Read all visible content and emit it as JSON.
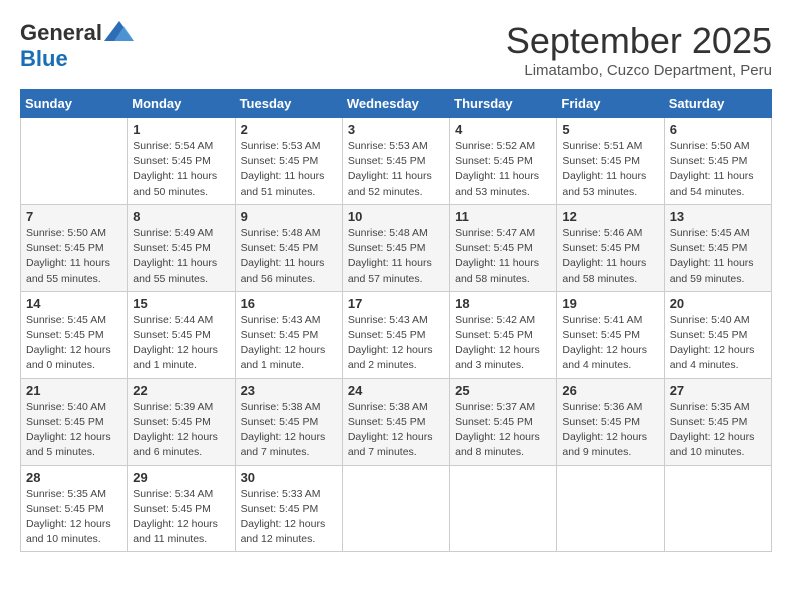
{
  "header": {
    "logo_general": "General",
    "logo_blue": "Blue",
    "month": "September 2025",
    "location": "Limatambo, Cuzco Department, Peru"
  },
  "days_of_week": [
    "Sunday",
    "Monday",
    "Tuesday",
    "Wednesday",
    "Thursday",
    "Friday",
    "Saturday"
  ],
  "weeks": [
    [
      {
        "day": "",
        "info": ""
      },
      {
        "day": "1",
        "info": "Sunrise: 5:54 AM\nSunset: 5:45 PM\nDaylight: 11 hours\nand 50 minutes."
      },
      {
        "day": "2",
        "info": "Sunrise: 5:53 AM\nSunset: 5:45 PM\nDaylight: 11 hours\nand 51 minutes."
      },
      {
        "day": "3",
        "info": "Sunrise: 5:53 AM\nSunset: 5:45 PM\nDaylight: 11 hours\nand 52 minutes."
      },
      {
        "day": "4",
        "info": "Sunrise: 5:52 AM\nSunset: 5:45 PM\nDaylight: 11 hours\nand 53 minutes."
      },
      {
        "day": "5",
        "info": "Sunrise: 5:51 AM\nSunset: 5:45 PM\nDaylight: 11 hours\nand 53 minutes."
      },
      {
        "day": "6",
        "info": "Sunrise: 5:50 AM\nSunset: 5:45 PM\nDaylight: 11 hours\nand 54 minutes."
      }
    ],
    [
      {
        "day": "7",
        "info": "Sunrise: 5:50 AM\nSunset: 5:45 PM\nDaylight: 11 hours\nand 55 minutes."
      },
      {
        "day": "8",
        "info": "Sunrise: 5:49 AM\nSunset: 5:45 PM\nDaylight: 11 hours\nand 55 minutes."
      },
      {
        "day": "9",
        "info": "Sunrise: 5:48 AM\nSunset: 5:45 PM\nDaylight: 11 hours\nand 56 minutes."
      },
      {
        "day": "10",
        "info": "Sunrise: 5:48 AM\nSunset: 5:45 PM\nDaylight: 11 hours\nand 57 minutes."
      },
      {
        "day": "11",
        "info": "Sunrise: 5:47 AM\nSunset: 5:45 PM\nDaylight: 11 hours\nand 58 minutes."
      },
      {
        "day": "12",
        "info": "Sunrise: 5:46 AM\nSunset: 5:45 PM\nDaylight: 11 hours\nand 58 minutes."
      },
      {
        "day": "13",
        "info": "Sunrise: 5:45 AM\nSunset: 5:45 PM\nDaylight: 11 hours\nand 59 minutes."
      }
    ],
    [
      {
        "day": "14",
        "info": "Sunrise: 5:45 AM\nSunset: 5:45 PM\nDaylight: 12 hours\nand 0 minutes."
      },
      {
        "day": "15",
        "info": "Sunrise: 5:44 AM\nSunset: 5:45 PM\nDaylight: 12 hours\nand 1 minute."
      },
      {
        "day": "16",
        "info": "Sunrise: 5:43 AM\nSunset: 5:45 PM\nDaylight: 12 hours\nand 1 minute."
      },
      {
        "day": "17",
        "info": "Sunrise: 5:43 AM\nSunset: 5:45 PM\nDaylight: 12 hours\nand 2 minutes."
      },
      {
        "day": "18",
        "info": "Sunrise: 5:42 AM\nSunset: 5:45 PM\nDaylight: 12 hours\nand 3 minutes."
      },
      {
        "day": "19",
        "info": "Sunrise: 5:41 AM\nSunset: 5:45 PM\nDaylight: 12 hours\nand 4 minutes."
      },
      {
        "day": "20",
        "info": "Sunrise: 5:40 AM\nSunset: 5:45 PM\nDaylight: 12 hours\nand 4 minutes."
      }
    ],
    [
      {
        "day": "21",
        "info": "Sunrise: 5:40 AM\nSunset: 5:45 PM\nDaylight: 12 hours\nand 5 minutes."
      },
      {
        "day": "22",
        "info": "Sunrise: 5:39 AM\nSunset: 5:45 PM\nDaylight: 12 hours\nand 6 minutes."
      },
      {
        "day": "23",
        "info": "Sunrise: 5:38 AM\nSunset: 5:45 PM\nDaylight: 12 hours\nand 7 minutes."
      },
      {
        "day": "24",
        "info": "Sunrise: 5:38 AM\nSunset: 5:45 PM\nDaylight: 12 hours\nand 7 minutes."
      },
      {
        "day": "25",
        "info": "Sunrise: 5:37 AM\nSunset: 5:45 PM\nDaylight: 12 hours\nand 8 minutes."
      },
      {
        "day": "26",
        "info": "Sunrise: 5:36 AM\nSunset: 5:45 PM\nDaylight: 12 hours\nand 9 minutes."
      },
      {
        "day": "27",
        "info": "Sunrise: 5:35 AM\nSunset: 5:45 PM\nDaylight: 12 hours\nand 10 minutes."
      }
    ],
    [
      {
        "day": "28",
        "info": "Sunrise: 5:35 AM\nSunset: 5:45 PM\nDaylight: 12 hours\nand 10 minutes."
      },
      {
        "day": "29",
        "info": "Sunrise: 5:34 AM\nSunset: 5:45 PM\nDaylight: 12 hours\nand 11 minutes."
      },
      {
        "day": "30",
        "info": "Sunrise: 5:33 AM\nSunset: 5:45 PM\nDaylight: 12 hours\nand 12 minutes."
      },
      {
        "day": "",
        "info": ""
      },
      {
        "day": "",
        "info": ""
      },
      {
        "day": "",
        "info": ""
      },
      {
        "day": "",
        "info": ""
      }
    ]
  ]
}
